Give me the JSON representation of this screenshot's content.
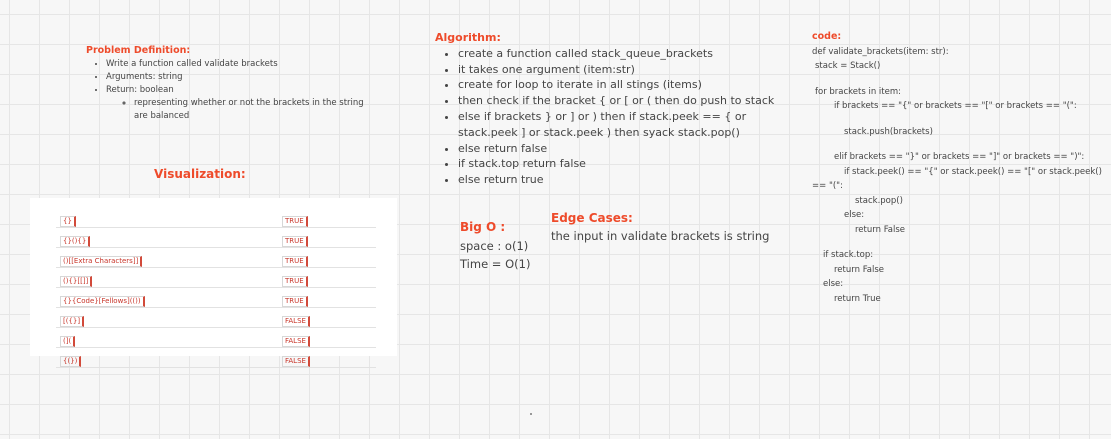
{
  "problem": {
    "title": "Problem Definition:",
    "items": [
      "Write a function called validate brackets",
      "Arguments: string",
      "Return: boolean"
    ],
    "subitem": "representing whether or not the brackets in the string are balanced"
  },
  "visualization": {
    "title": "Visualization:",
    "rows": [
      {
        "input": "{}",
        "result": "TRUE"
      },
      {
        "input": "{}(){}",
        "result": "TRUE"
      },
      {
        "input": "()[[Extra Characters]]",
        "result": "TRUE"
      },
      {
        "input": "(){}[[]]",
        "result": "TRUE"
      },
      {
        "input": "{}{Code}[Fellows](())",
        "result": "TRUE"
      },
      {
        "input": "[({}]",
        "result": "FALSE"
      },
      {
        "input": "(](",
        "result": "FALSE"
      },
      {
        "input": "{(})",
        "result": "FALSE"
      }
    ]
  },
  "algorithm": {
    "title": "Algorithm:",
    "items": [
      "create a function called stack_queue_brackets",
      "it takes one argument (item:str)",
      "create for loop to iterate in all stings (items)",
      "then check if the bracket { or [ or ( then do push to stack",
      "else if brackets } or ] or ) then if stack.peek == { or stack.peek ] or stack.peek ) then syack stack.pop()",
      "else return false",
      "if stack.top return false",
      "else return true"
    ]
  },
  "bigo": {
    "title": "Big O :",
    "space": "space : o(1)",
    "time": "Time = O(1)"
  },
  "edge": {
    "title": "Edge Cases:",
    "text": "the input in validate brackets is string"
  },
  "code": {
    "title": "code:",
    "l1": "def validate_brackets(item: str):",
    "l2": "stack = Stack()",
    "l3": "for brackets in item:",
    "l4": "if brackets == \"{\" or brackets == \"[\" or brackets == \"(\":",
    "l5": "stack.push(brackets)",
    "l6": "elif brackets == \"}\" or brackets == \"]\" or brackets == \")\":",
    "l7": "if stack.peek() == \"{\" or stack.peek() == \"[\" or stack.peek() == \"(\":",
    "l8": "stack.pop()",
    "l9": "else:",
    "l10": "return False",
    "l11": "if stack.top:",
    "l12": "return False",
    "l13": "else:",
    "l14": "return True"
  },
  "colors": {
    "accent": "#ee4b2b",
    "grid": "#e6e6e6",
    "background": "#f7f7f7"
  }
}
